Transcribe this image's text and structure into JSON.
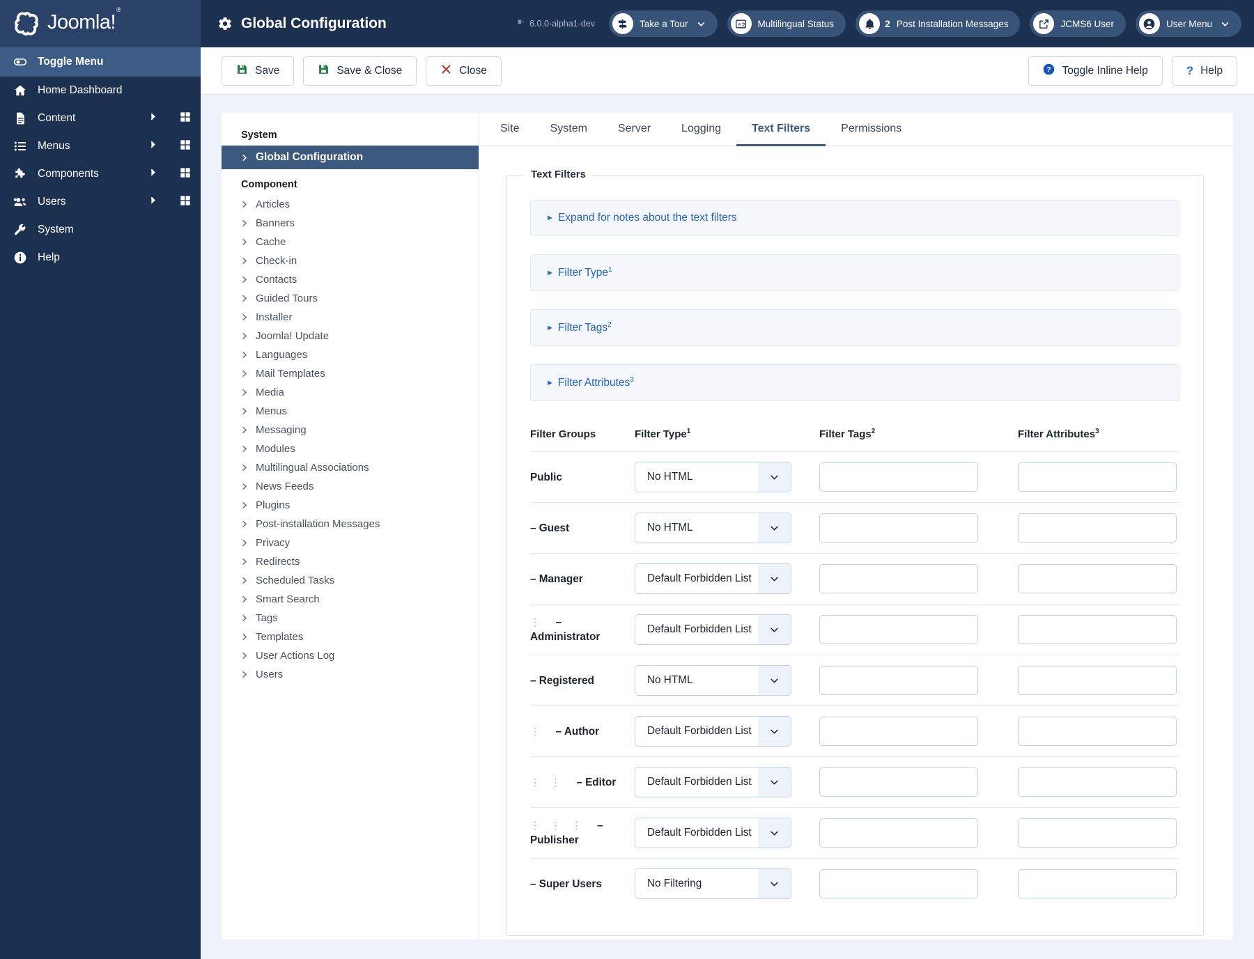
{
  "brand": {
    "name": "Joomla!",
    "trademark": "®",
    "logo_icon": "joomla-logo-icon"
  },
  "header": {
    "title": "Global Configuration",
    "title_icon": "gear-icon",
    "version": "6.0.0-alpha1-dev",
    "version_icon": "joomla-mark-icon",
    "pills": [
      {
        "label": "Take a Tour",
        "icon": "signpost-icon",
        "has_chevron": true
      },
      {
        "label": "Multilingual Status",
        "icon": "translate-icon",
        "has_chevron": false
      },
      {
        "label": "Post Installation Messages",
        "icon": "bell-icon",
        "badge": "2",
        "has_chevron": false
      },
      {
        "label": "JCMS6 User",
        "icon": "external-link-icon",
        "has_chevron": false
      },
      {
        "label": "User Menu",
        "icon": "user-circle-icon",
        "has_chevron": true
      }
    ]
  },
  "sidebar": {
    "items": [
      {
        "label": "Toggle Menu",
        "icon": "toggle-icon",
        "active": true,
        "arrow": false,
        "grid": false
      },
      {
        "label": "Home Dashboard",
        "icon": "home-icon",
        "active": false,
        "arrow": false,
        "grid": false
      },
      {
        "label": "Content",
        "icon": "document-icon",
        "active": false,
        "arrow": true,
        "grid": true
      },
      {
        "label": "Menus",
        "icon": "list-icon",
        "active": false,
        "arrow": true,
        "grid": true
      },
      {
        "label": "Components",
        "icon": "puzzle-icon",
        "active": false,
        "arrow": true,
        "grid": true
      },
      {
        "label": "Users",
        "icon": "users-icon",
        "active": false,
        "arrow": true,
        "grid": true
      },
      {
        "label": "System",
        "icon": "wrench-icon",
        "active": false,
        "arrow": false,
        "grid": false
      },
      {
        "label": "Help",
        "icon": "info-icon",
        "active": false,
        "arrow": false,
        "grid": false
      }
    ]
  },
  "toolbar": {
    "save_label": "Save",
    "save_close_label": "Save & Close",
    "close_label": "Close",
    "toggle_inline_help_label": "Toggle Inline Help",
    "help_label": "Help",
    "save_icon": "floppy-disk-icon",
    "close_icon": "x-icon",
    "help_icon": "question-circle-icon"
  },
  "config_list": {
    "group_system_label": "System",
    "group_component_label": "Component",
    "system_items": [
      {
        "label": "Global Configuration",
        "active": true
      }
    ],
    "component_items": [
      {
        "label": "Articles"
      },
      {
        "label": "Banners"
      },
      {
        "label": "Cache"
      },
      {
        "label": "Check-in"
      },
      {
        "label": "Contacts"
      },
      {
        "label": "Guided Tours"
      },
      {
        "label": "Installer"
      },
      {
        "label": "Joomla! Update"
      },
      {
        "label": "Languages"
      },
      {
        "label": "Mail Templates"
      },
      {
        "label": "Media"
      },
      {
        "label": "Menus"
      },
      {
        "label": "Messaging"
      },
      {
        "label": "Modules"
      },
      {
        "label": "Multilingual Associations"
      },
      {
        "label": "News Feeds"
      },
      {
        "label": "Plugins"
      },
      {
        "label": "Post-installation Messages"
      },
      {
        "label": "Privacy"
      },
      {
        "label": "Redirects"
      },
      {
        "label": "Scheduled Tasks"
      },
      {
        "label": "Smart Search"
      },
      {
        "label": "Tags"
      },
      {
        "label": "Templates"
      },
      {
        "label": "User Actions Log"
      },
      {
        "label": "Users"
      }
    ]
  },
  "tabs": [
    {
      "label": "Site",
      "active": false
    },
    {
      "label": "System",
      "active": false
    },
    {
      "label": "Server",
      "active": false
    },
    {
      "label": "Logging",
      "active": false
    },
    {
      "label": "Text Filters",
      "active": true
    },
    {
      "label": "Permissions",
      "active": false
    }
  ],
  "main": {
    "fieldset_legend": "Text Filters",
    "accordions": [
      {
        "label": "Expand for notes about the text filters",
        "sup": ""
      },
      {
        "label": "Filter Type",
        "sup": "1"
      },
      {
        "label": "Filter Tags",
        "sup": "2"
      },
      {
        "label": "Filter Attributes",
        "sup": "3"
      }
    ],
    "table": {
      "headers": [
        {
          "label": "Filter Groups",
          "sup": ""
        },
        {
          "label": "Filter Type",
          "sup": "1"
        },
        {
          "label": "Filter Tags",
          "sup": "2"
        },
        {
          "label": "Filter Attributes",
          "sup": "3"
        }
      ],
      "rows": [
        {
          "group": "Public",
          "depth": 0,
          "dash": false,
          "filter_type": "No HTML",
          "tags": "",
          "attributes": ""
        },
        {
          "group": "Guest",
          "depth": 0,
          "dash": true,
          "filter_type": "No HTML",
          "tags": "",
          "attributes": ""
        },
        {
          "group": "Manager",
          "depth": 0,
          "dash": true,
          "filter_type": "Default Forbidden List",
          "tags": "",
          "attributes": ""
        },
        {
          "group": "Administrator",
          "depth": 1,
          "dash": true,
          "filter_type": "Default Forbidden List",
          "tags": "",
          "attributes": ""
        },
        {
          "group": "Registered",
          "depth": 0,
          "dash": true,
          "filter_type": "No HTML",
          "tags": "",
          "attributes": ""
        },
        {
          "group": "Author",
          "depth": 1,
          "dash": true,
          "filter_type": "Default Forbidden List",
          "tags": "",
          "attributes": ""
        },
        {
          "group": "Editor",
          "depth": 2,
          "dash": true,
          "filter_type": "Default Forbidden List",
          "tags": "",
          "attributes": ""
        },
        {
          "group": "Publisher",
          "depth": 3,
          "dash": true,
          "filter_type": "Default Forbidden List",
          "tags": "",
          "attributes": ""
        },
        {
          "group": "Super Users",
          "depth": 0,
          "dash": true,
          "filter_type": "No Filtering",
          "tags": "",
          "attributes": ""
        }
      ]
    }
  },
  "colors": {
    "brand_dark": "#1c3050",
    "brand_mid": "#2a4268",
    "accent": "#3c5a80",
    "link": "#2563c4",
    "save_green": "#1f7a3d",
    "close_red": "#c0392b"
  }
}
